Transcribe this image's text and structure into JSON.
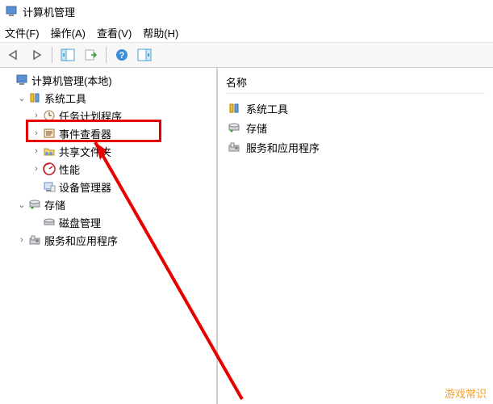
{
  "title": "计算机管理",
  "menu": {
    "file": "文件(F)",
    "action": "操作(A)",
    "view": "查看(V)",
    "help": "帮助(H)"
  },
  "tree": {
    "root": "计算机管理(本地)",
    "system_tools": "系统工具",
    "task_scheduler": "任务计划程序",
    "event_viewer": "事件查看器",
    "shared_folders": "共享文件夹",
    "performance": "性能",
    "device_manager": "设备管理器",
    "storage": "存储",
    "disk_mgmt": "磁盘管理",
    "services_apps": "服务和应用程序"
  },
  "right": {
    "header": "名称",
    "items": {
      "system_tools": "系统工具",
      "storage": "存储",
      "services_apps": "服务和应用程序"
    }
  },
  "watermark": "游戏常识"
}
